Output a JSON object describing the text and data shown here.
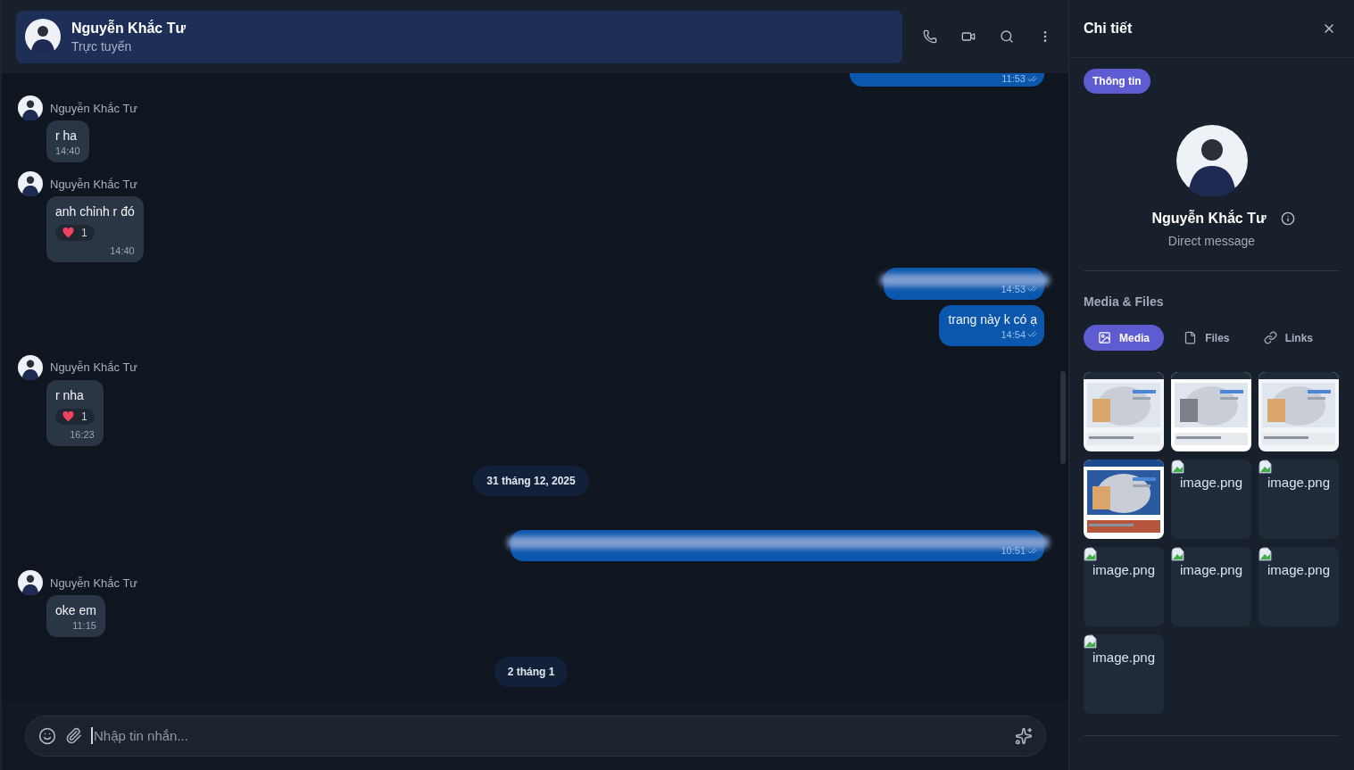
{
  "header": {
    "name": "Nguyễn Khắc Tư",
    "status": "Trực tuyến"
  },
  "messages": [
    {
      "kind": "outgoing",
      "time": "11:53",
      "read": true
    },
    {
      "kind": "incoming",
      "sender": "Nguyễn Khắc Tư",
      "text": "r ha",
      "time": "14:40"
    },
    {
      "kind": "incoming",
      "sender": "Nguyễn Khắc Tư",
      "text": "anh chỉnh r đó",
      "reaction": {
        "count": "1"
      },
      "time": "14:40"
    },
    {
      "kind": "redacted",
      "long": false,
      "time": "14:53",
      "read": true
    },
    {
      "kind": "outgoing",
      "text": "trang này k có ạ",
      "time": "14:54",
      "read": true
    },
    {
      "kind": "incoming",
      "sender": "Nguyễn Khắc Tư",
      "text": "r nha",
      "reaction": {
        "count": "1"
      },
      "time": "16:23"
    },
    {
      "kind": "date",
      "text": "31 tháng 12, 2025"
    },
    {
      "kind": "redacted",
      "long": true,
      "time": "10:51",
      "read": true
    },
    {
      "kind": "incoming",
      "sender": "Nguyễn Khắc Tư",
      "text": "oke em",
      "time": "11:15"
    },
    {
      "kind": "date",
      "text": "2 tháng 1"
    }
  ],
  "composer": {
    "placeholder": "Nhập tin nhắn..."
  },
  "details": {
    "title": "Chi tiết",
    "tabs": [
      {
        "label": "Thông tin",
        "selected": true
      }
    ],
    "profile": {
      "name": "Nguyễn Khắc Tư",
      "subtitle": "Direct message"
    },
    "media_title": "Media & Files",
    "media_tabs": [
      {
        "label": "Media",
        "selected": true
      },
      {
        "label": "Files",
        "selected": false
      },
      {
        "label": "Links",
        "selected": false
      }
    ],
    "media": [
      {
        "kind": "picture"
      },
      {
        "kind": "picture"
      },
      {
        "kind": "picture"
      },
      {
        "kind": "picture"
      },
      {
        "kind": "broken",
        "name": "image.png"
      },
      {
        "kind": "broken",
        "name": "image.png"
      },
      {
        "kind": "broken",
        "name": "image.png"
      },
      {
        "kind": "broken",
        "name": "image.png"
      },
      {
        "kind": "broken",
        "name": "image.png"
      },
      {
        "kind": "broken",
        "name": "image.png"
      }
    ]
  }
}
